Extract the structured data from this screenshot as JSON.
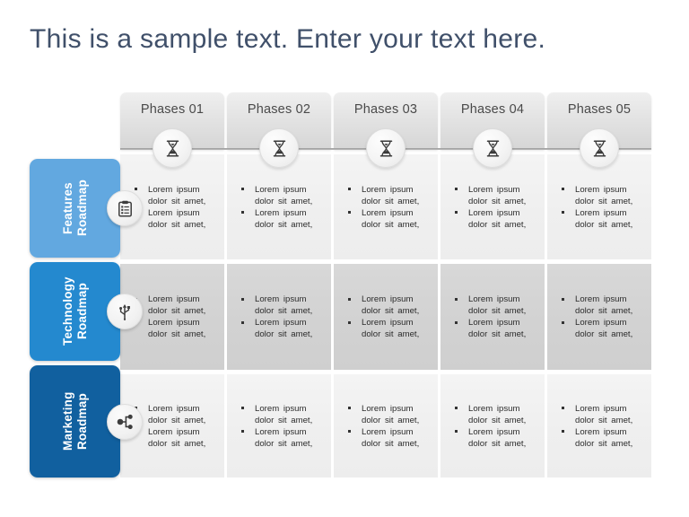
{
  "page": {
    "title": "This is a sample text. Enter your text here.",
    "title_color": "#40506a",
    "background": "#ffffff"
  },
  "header": {
    "phases": [
      {
        "label": "Phases 01",
        "icon": "hourglass-icon"
      },
      {
        "label": "Phases 02",
        "icon": "hourglass-icon"
      },
      {
        "label": "Phases 03",
        "icon": "hourglass-icon"
      },
      {
        "label": "Phases 04",
        "icon": "hourglass-icon"
      },
      {
        "label": "Phases 05",
        "icon": "hourglass-icon"
      }
    ]
  },
  "rows": [
    {
      "label": "Features Roadmap",
      "icon": "clipboard-icon",
      "color": "#62a8e0",
      "band": "light",
      "cells": [
        {
          "bullets": [
            "Lorem ipsum dolor sit amet,",
            "Lorem ipsum dolor sit amet,"
          ]
        },
        {
          "bullets": [
            "Lorem ipsum dolor sit amet,",
            "Lorem ipsum dolor sit amet,"
          ]
        },
        {
          "bullets": [
            "Lorem ipsum dolor sit amet,",
            "Lorem ipsum dolor sit amet,"
          ]
        },
        {
          "bullets": [
            "Lorem ipsum dolor sit amet,",
            "Lorem ipsum dolor sit amet,"
          ]
        },
        {
          "bullets": [
            "Lorem ipsum dolor sit amet,",
            "Lorem ipsum dolor sit amet,"
          ]
        }
      ]
    },
    {
      "label": "Technology Roadmap",
      "icon": "usb-icon",
      "color": "#2489cf",
      "band": "dark",
      "cells": [
        {
          "bullets": [
            "Lorem ipsum dolor sit amet,",
            "Lorem ipsum dolor sit amet,"
          ]
        },
        {
          "bullets": [
            "Lorem ipsum dolor sit amet,",
            "Lorem ipsum dolor sit amet,"
          ]
        },
        {
          "bullets": [
            "Lorem ipsum dolor sit amet,",
            "Lorem ipsum dolor sit amet,"
          ]
        },
        {
          "bullets": [
            "Lorem ipsum dolor sit amet,",
            "Lorem ipsum dolor sit amet,"
          ]
        },
        {
          "bullets": [
            "Lorem ipsum dolor sit amet,",
            "Lorem ipsum dolor sit amet,"
          ]
        }
      ]
    },
    {
      "label": "Marketing Roadmap",
      "icon": "share-nodes-icon",
      "color": "#11609f",
      "band": "light",
      "cells": [
        {
          "bullets": [
            "Lorem ipsum dolor sit amet,",
            "Lorem ipsum dolor sit amet,"
          ]
        },
        {
          "bullets": [
            "Lorem ipsum dolor sit amet,",
            "Lorem ipsum dolor sit amet,"
          ]
        },
        {
          "bullets": [
            "Lorem ipsum dolor sit amet,",
            "Lorem ipsum dolor sit amet,"
          ]
        },
        {
          "bullets": [
            "Lorem ipsum dolor sit amet,",
            "Lorem ipsum dolor sit amet,"
          ]
        },
        {
          "bullets": [
            "Lorem ipsum dolor sit amet,",
            "Lorem ipsum dolor sit amet,"
          ]
        }
      ]
    }
  ]
}
